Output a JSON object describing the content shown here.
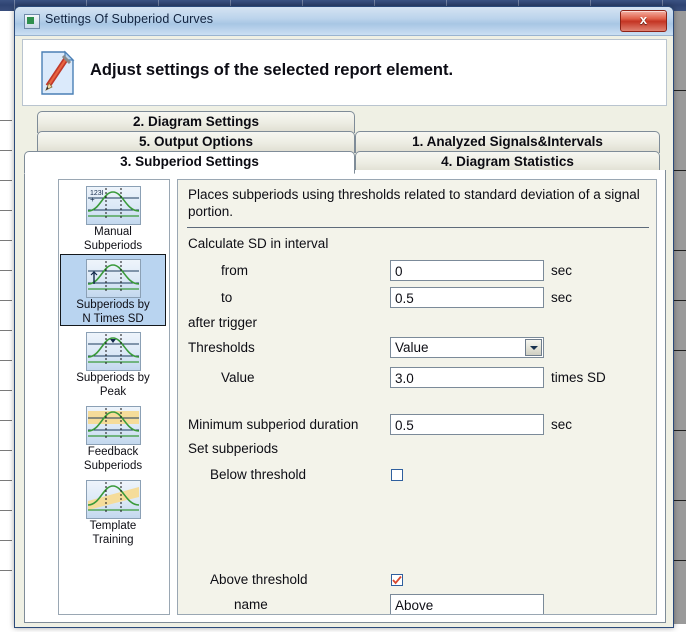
{
  "window": {
    "title": "Settings Of Subperiod Curves",
    "icon": "app-icon",
    "close_label": "x"
  },
  "header": {
    "icon": "document-pencil-icon",
    "title": "Adjust settings of the selected report element."
  },
  "tabs": [
    {
      "label": "2. Diagram Settings",
      "active": false
    },
    {
      "label": "5. Output Options",
      "active": false
    },
    {
      "label": "3. Subperiod Settings",
      "active": true
    },
    {
      "label": "1. Analyzed Signals&Intervals",
      "active": false
    },
    {
      "label": "4. Diagram Statistics",
      "active": false
    }
  ],
  "sidebar": {
    "items": [
      {
        "label": "Manual\nSubperiods",
        "line1": "Manual",
        "line2": "Subperiods",
        "icon": "manual-subperiods-icon",
        "selected": false
      },
      {
        "label": "Subperiods by N Times SD",
        "line1": "Subperiods by",
        "line2": "N Times SD",
        "icon": "subperiods-by-n-times-sd-icon",
        "selected": true
      },
      {
        "label": "Subperiods by Peak",
        "line1": "Subperiods by",
        "line2": "Peak",
        "icon": "subperiods-by-peak-icon",
        "selected": false
      },
      {
        "label": "Feedback Subperiods",
        "line1": "Feedback",
        "line2": "Subperiods",
        "icon": "feedback-subperiods-icon",
        "selected": false
      },
      {
        "label": "Template Training",
        "line1": "Template",
        "line2": "Training",
        "icon": "template-training-icon",
        "selected": false
      }
    ]
  },
  "form": {
    "description": "Places subperiods using thresholds related to standard deviation of a signal portion.",
    "calculate_sd_label": "Calculate SD in interval",
    "from_label": "from",
    "from_value": "0",
    "from_unit": "sec",
    "to_label": "to",
    "to_value": "0.5",
    "to_unit": "sec",
    "after_trigger_label": "after trigger",
    "thresholds_label": "Thresholds",
    "thresholds_value": "Value",
    "thresholds_options": [
      "Value"
    ],
    "value_label": "Value",
    "value_value": "3.0",
    "value_unit": "times SD",
    "min_duration_label": "Minimum subperiod duration",
    "min_duration_value": "0.5",
    "min_duration_unit": "sec",
    "set_subperiods_label": "Set subperiods",
    "below_threshold_label": "Below threshold",
    "below_threshold_checked": false,
    "above_threshold_label": "Above threshold",
    "above_threshold_checked": true,
    "name_label": "name",
    "name_value": "Above"
  },
  "colors": {
    "accent": "#b9d4f0",
    "close_red": "#c43423",
    "check_red": "#d84a32",
    "curve_green": "#3a9a3a",
    "panel_bg": "#f3f3ea",
    "titlebar": "#a8c6e4"
  }
}
